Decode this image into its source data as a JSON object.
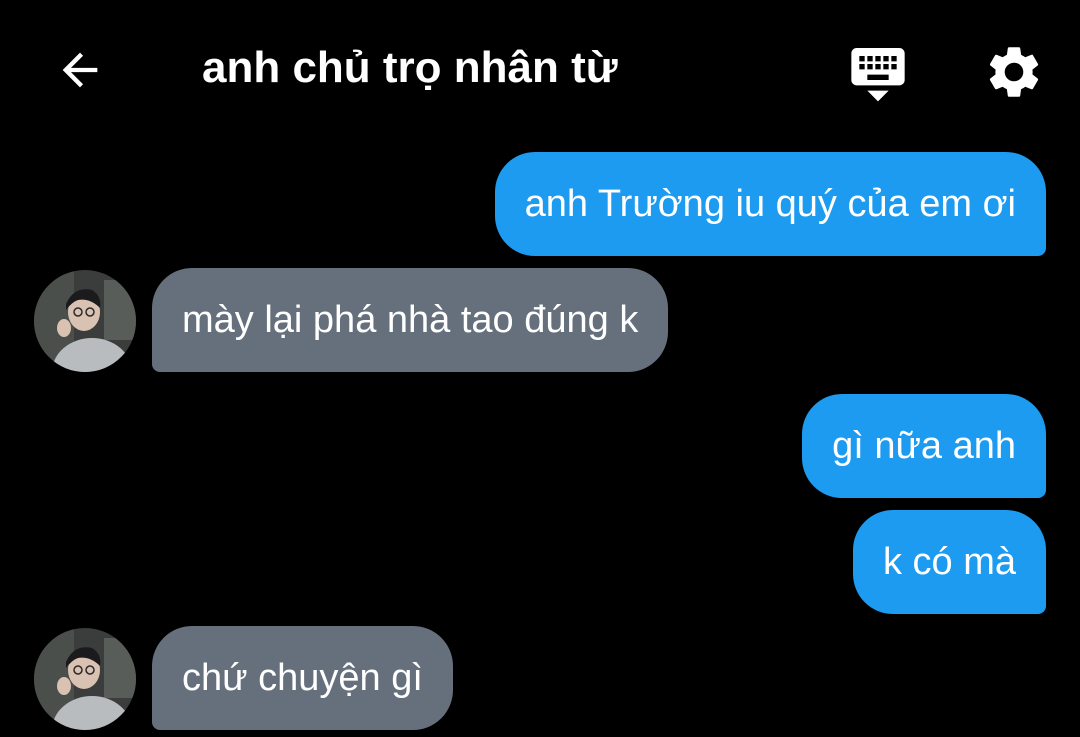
{
  "header": {
    "title": "anh chủ trọ nhân từ",
    "back_icon": "arrow-left-icon",
    "keyboard_icon": "keyboard-hide-icon",
    "settings_icon": "gear-icon"
  },
  "colors": {
    "background": "#000000",
    "sent_bubble": "#1d9bf0",
    "received_bubble": "#66707d",
    "text": "#ffffff"
  },
  "messages": [
    {
      "side": "sent",
      "text": "anh Trường iu quý của em ơi"
    },
    {
      "side": "received",
      "text": "mày lại phá nhà tao đúng k"
    },
    {
      "side": "sent",
      "text": "gì nữa anh"
    },
    {
      "side": "sent",
      "text": "k có mà"
    },
    {
      "side": "received",
      "text": "chứ chuyện gì"
    }
  ]
}
